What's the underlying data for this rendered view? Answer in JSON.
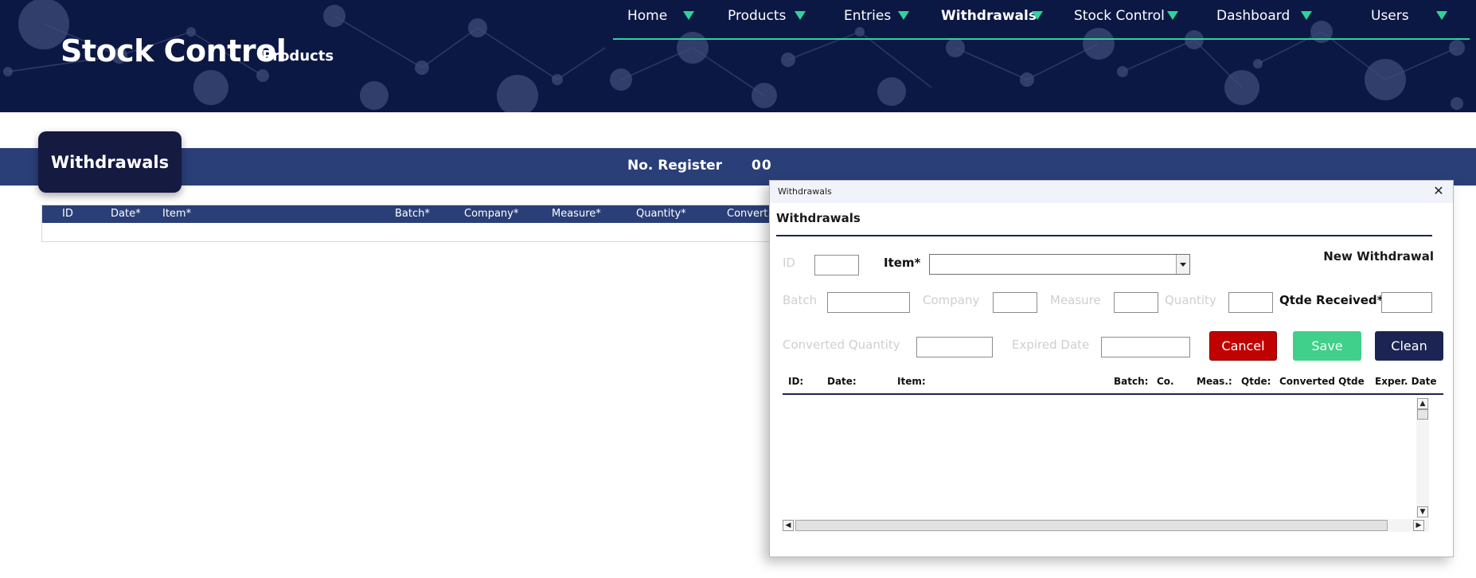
{
  "header": {
    "title": "Stock Control",
    "subtitle": "Products",
    "nav": [
      {
        "label": "Home",
        "active": false
      },
      {
        "label": "Products",
        "active": false
      },
      {
        "label": "Entries",
        "active": false
      },
      {
        "label": "Withdrawals",
        "active": true
      },
      {
        "label": "Stock Control",
        "active": false
      },
      {
        "label": "Dashboard",
        "active": false
      },
      {
        "label": "Users",
        "active": false
      }
    ]
  },
  "section": {
    "title": "Withdrawals",
    "register_label": "No. Register",
    "register_value": "00"
  },
  "table": {
    "columns": [
      "ID",
      "Date*",
      "Item*",
      "Batch*",
      "Company*",
      "Measure*",
      "Quantity*",
      "Convert."
    ]
  },
  "dialog": {
    "window_title": "Withdrawals",
    "heading": "Withdrawals",
    "mode_label": "New Withdrawal",
    "fields": {
      "id": "ID",
      "item": "Item*",
      "batch": "Batch",
      "company": "Company",
      "measure": "Measure",
      "quantity": "Quantity",
      "qtde_received": "Qtde Received*",
      "converted_quantity": "Converted Quantity",
      "expired_date": "Expired Date"
    },
    "buttons": {
      "cancel": "Cancel",
      "save": "Save",
      "clean": "Clean"
    },
    "list_columns": [
      "ID:",
      "Date:",
      "Item:",
      "Batch:",
      "Co.",
      "Meas.:",
      "Qtde:",
      "Converted Qtde",
      "Exper. Date"
    ]
  },
  "colors": {
    "header_bg": "#0c1844",
    "accent": "#2fd39a",
    "strip": "#2a3f78",
    "cancel": "#c10000",
    "save": "#41cf8c",
    "clean": "#1b2452"
  }
}
